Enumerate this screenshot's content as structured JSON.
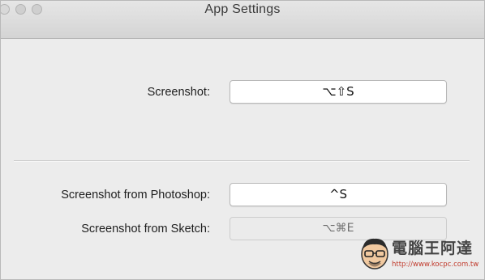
{
  "window": {
    "title": "App Settings"
  },
  "shortcuts": {
    "screenshot": {
      "label": "Screenshot:",
      "value": "⌥⇧S",
      "enabled": true
    },
    "screenshot_photoshop": {
      "label": "Screenshot from Photoshop:",
      "value": "^S",
      "enabled": true
    },
    "screenshot_sketch": {
      "label": "Screenshot from Sketch:",
      "value": "⌥⌘E",
      "enabled": false
    }
  },
  "watermark": {
    "brand": "電腦王阿達",
    "url": "http://www.kocpc.com.tw"
  },
  "colors": {
    "window_bg": "#ececec",
    "titlebar": "#d9d9d9",
    "field_bg": "#ffffff",
    "field_disabled_bg": "#ebebeb",
    "watermark_url": "#c0392b"
  }
}
